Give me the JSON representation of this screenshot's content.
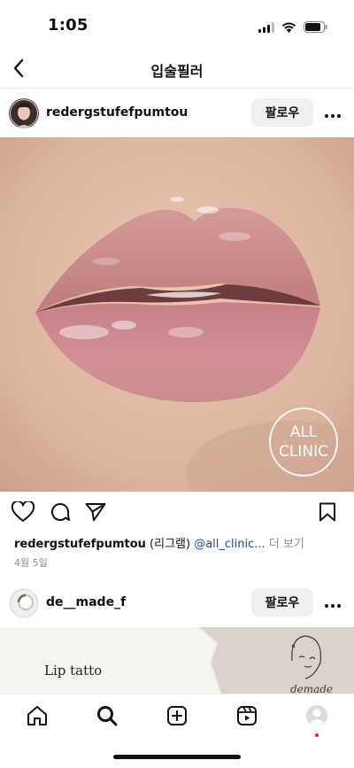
{
  "status_bar": {
    "time": "1:05"
  },
  "nav": {
    "title": "입술필러"
  },
  "post": {
    "username": "redergstufefpumtou",
    "follow_label": "팔로우",
    "watermark_line1": "ALL",
    "watermark_line2": "CLINIC",
    "caption": {
      "username": "redergstufefpumtou",
      "text": " (리그램) ",
      "mention": "@all_clinic...",
      "more": " 더 보기"
    },
    "date": "4월 5일"
  },
  "next_post": {
    "username": "de__made_f",
    "follow_label": "팔로우",
    "preview_text": "Lip tatto",
    "logo_text": "demade"
  },
  "colors": {
    "mention": "#1e4b8c",
    "muted": "#8e8e8e",
    "notification_dot": "#e0245e"
  },
  "icons": [
    "back-icon",
    "more-icon",
    "heart-icon",
    "comment-icon",
    "share-icon",
    "bookmark-icon",
    "home-icon",
    "search-icon",
    "create-icon",
    "reels-icon",
    "profile-icon"
  ]
}
